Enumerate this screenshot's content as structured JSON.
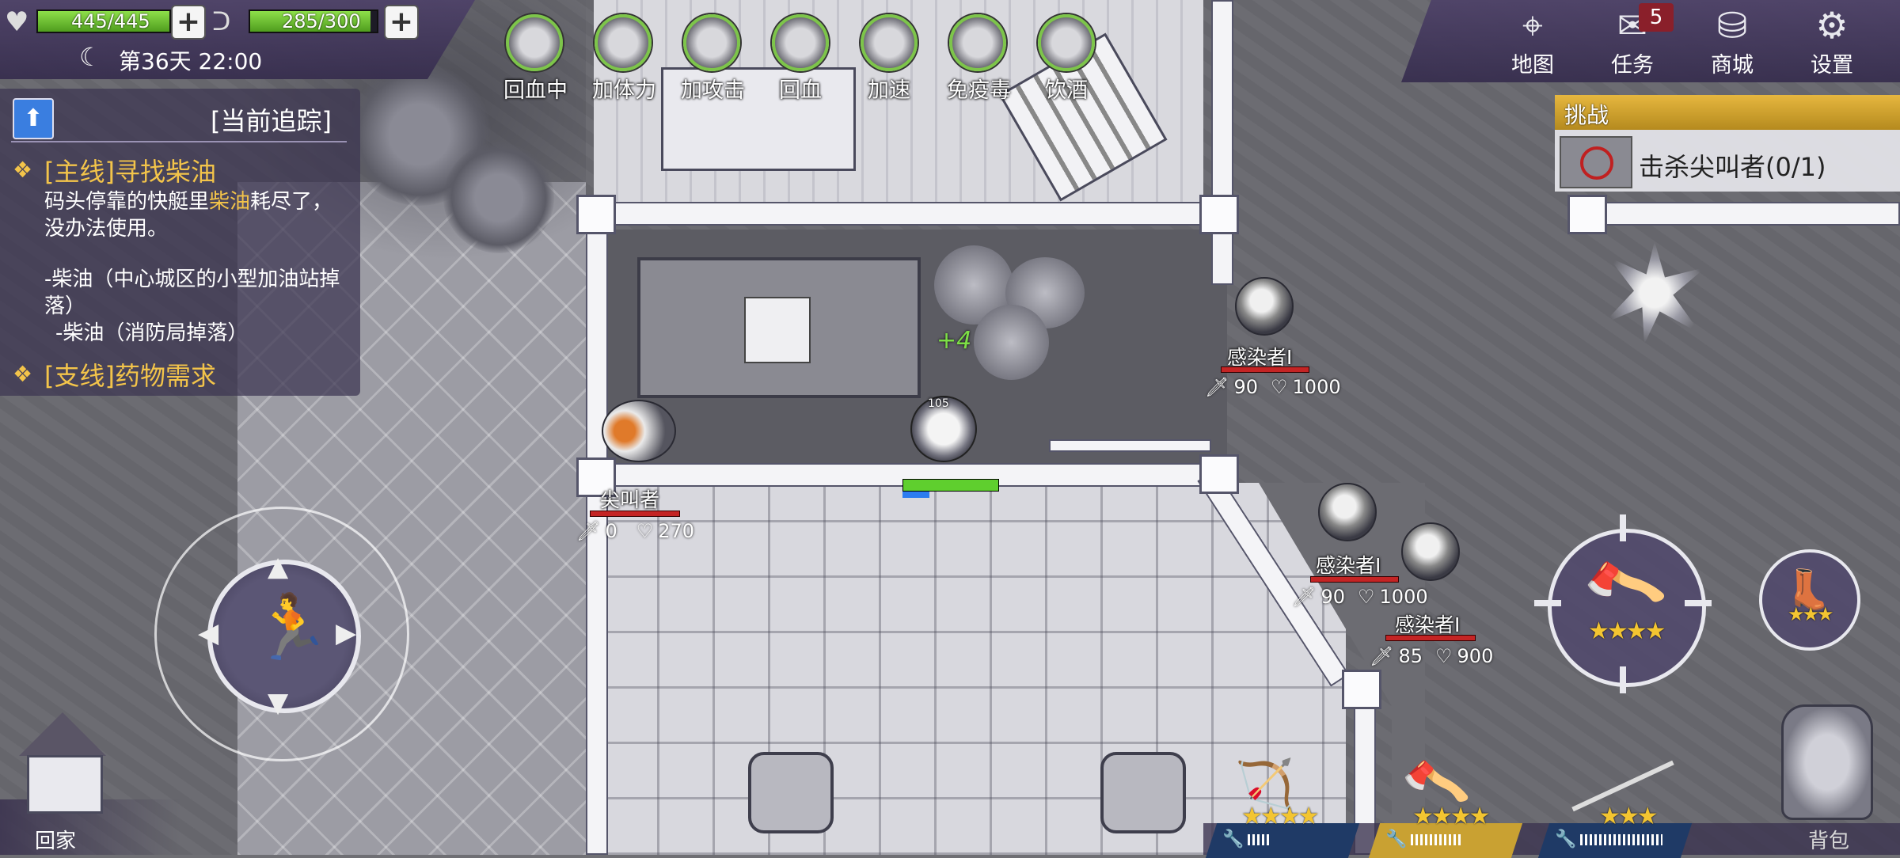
{
  "stats": {
    "hp": {
      "current": 445,
      "max": 445,
      "label": "445/445",
      "fill": 1.0
    },
    "hunger": {
      "current": 285,
      "max": 300,
      "label": "285/300",
      "fill": 0.95
    },
    "time": "第36天 22:00"
  },
  "buffs": [
    {
      "label": "回血中",
      "icon": "muscle-icon"
    },
    {
      "label": "加体力",
      "icon": "food-icon"
    },
    {
      "label": "加攻击",
      "icon": "pan-icon"
    },
    {
      "label": "回血",
      "icon": "bowl-icon"
    },
    {
      "label": "加速",
      "icon": "bottle-icon"
    },
    {
      "label": "免疫毒",
      "icon": "medicine-icon"
    },
    {
      "label": "饮酒",
      "icon": "wine-icon"
    }
  ],
  "top_menu": [
    {
      "label": "地图",
      "icon": "map-icon"
    },
    {
      "label": "任务",
      "icon": "scroll-icon",
      "badge": "5"
    },
    {
      "label": "商城",
      "icon": "coins-icon"
    },
    {
      "label": "设置",
      "icon": "gear-icon"
    }
  ],
  "quest_panel": {
    "title": "[当前追踪]",
    "main_title": "[主线]寻找柴油",
    "desc_before": "码头停靠的快艇里",
    "desc_highlight": "柴油",
    "desc_after": "耗尽了，没办法使用。",
    "item1": "-柴油（中心城区的小型加油站掉落）",
    "item2": "-柴油（消防局掉落）",
    "side_title": "[支线]药物需求"
  },
  "challenge": {
    "header": "挑战",
    "text": "击杀尖叫者(0/1)"
  },
  "enemies": [
    {
      "name": "感染者I",
      "atk": "90",
      "hp": "1000"
    },
    {
      "name": "感染者I",
      "atk": "90",
      "hp": "1000"
    },
    {
      "name": "感染者I",
      "atk": "85",
      "hp": "900"
    },
    {
      "name": "尖叫者",
      "atk": "0",
      "hp": "270"
    }
  ],
  "player": {
    "level": "105",
    "popup": "+4"
  },
  "weapons": {
    "main": {
      "stars": "★★★★",
      "icon": "axe-icon"
    },
    "secondary": {
      "stars": "★★★",
      "icon": "boots-icon"
    },
    "slots": [
      {
        "stars": "★★★★",
        "icon": "bow-icon",
        "color": "#1f3a66",
        "durability": 0.25
      },
      {
        "stars": "★★★★",
        "icon": "axe-icon",
        "color": "#c9a132",
        "durability": 0.6
      },
      {
        "stars": "★★★",
        "icon": "spear-icon",
        "color": "#1f3a66",
        "durability": 0.95
      }
    ]
  },
  "bottom": {
    "home": "回家",
    "bag": "背包"
  },
  "colors": {
    "hp_green": "#6fc23a",
    "enemy_hp": "#c42424",
    "gold": "#f3c44a",
    "panel": "#4e4268"
  }
}
